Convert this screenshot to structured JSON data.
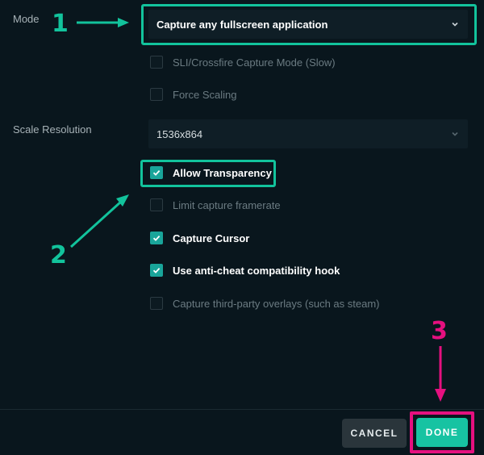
{
  "mode": {
    "label": "Mode",
    "value": "Capture any fullscreen application"
  },
  "options_top": [
    {
      "label": "SLI/Crossfire Capture Mode (Slow)",
      "checked": false
    },
    {
      "label": "Force Scaling",
      "checked": false
    }
  ],
  "scale": {
    "label": "Scale Resolution",
    "value": "1536x864"
  },
  "options": [
    {
      "label": "Allow Transparency",
      "checked": true
    },
    {
      "label": "Limit capture framerate",
      "checked": false
    },
    {
      "label": "Capture Cursor",
      "checked": true
    },
    {
      "label": "Use anti-cheat compatibility hook",
      "checked": true
    },
    {
      "label": "Capture third-party overlays (such as steam)",
      "checked": false
    }
  ],
  "footer": {
    "cancel_label": "CANCEL",
    "done_label": "DONE"
  },
  "annotations": {
    "step1": "1",
    "step2": "2",
    "step3": "3",
    "green_color": "#12c39c",
    "pink_color": "#e5107f"
  },
  "colors": {
    "background": "#09161d",
    "accent": "#17c3a2",
    "checkbox_checked": "#19a59a"
  }
}
